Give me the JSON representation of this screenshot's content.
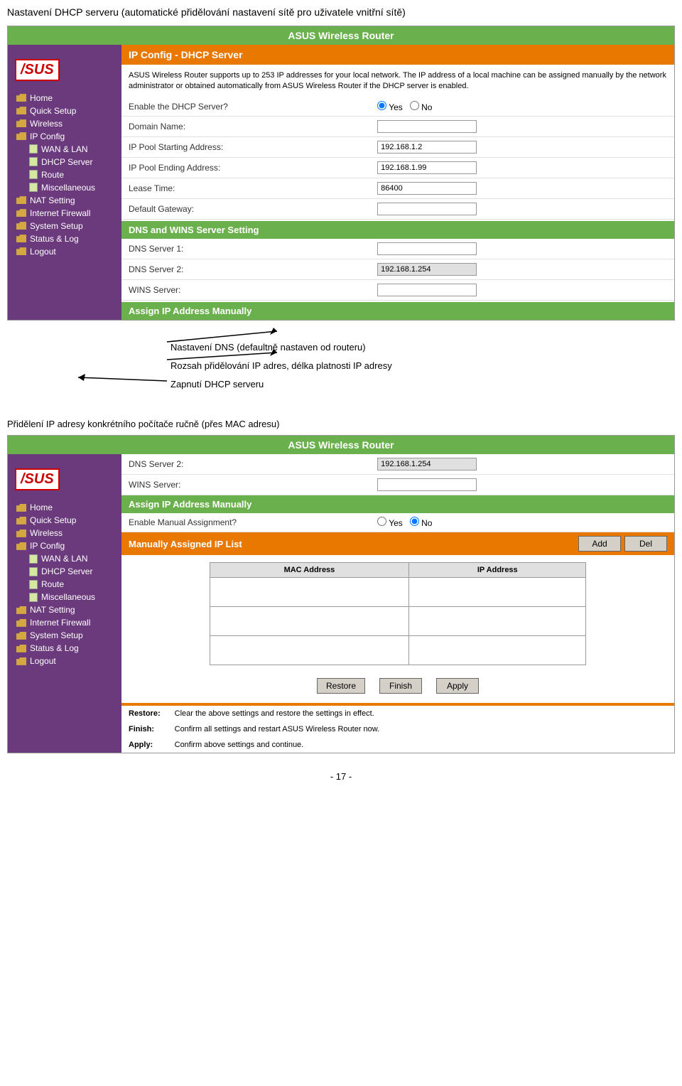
{
  "page": {
    "header": "Nastavení DHCP serveru (automatické přidělování nastavení sítě pro uživatele vnitřní sítě)",
    "router_title": "ASUS Wireless Router",
    "asus_logo": "/sus",
    "section1_title": "IP Config - DHCP Server",
    "info_text": "ASUS Wireless Router supports up to 253 IP addresses for your local network. The IP address of a local machine can be assigned manually by the network administrator or obtained automatically from ASUS Wireless Router if the DHCP server is enabled.",
    "fields": [
      {
        "label": "Enable the DHCP Server?",
        "type": "radio",
        "value": "Yes"
      },
      {
        "label": "Domain Name:",
        "type": "text",
        "value": ""
      },
      {
        "label": "IP Pool Starting Address:",
        "type": "text",
        "value": "192.168.1.2"
      },
      {
        "label": "IP Pool Ending Address:",
        "type": "text",
        "value": "192.168.1.99"
      },
      {
        "label": "Lease Time:",
        "type": "text",
        "value": "86400"
      },
      {
        "label": "Default Gateway:",
        "type": "text",
        "value": ""
      }
    ],
    "dns_section": "DNS and WINS Server Setting",
    "dns_fields": [
      {
        "label": "DNS Server 1:",
        "type": "text",
        "value": ""
      },
      {
        "label": "DNS Server 2:",
        "type": "text",
        "value": "192.168.1.254"
      },
      {
        "label": "WINS Server:",
        "type": "text",
        "value": ""
      }
    ],
    "assign_section": "Assign IP Address Manually",
    "sidebar_items": [
      {
        "label": "Home",
        "type": "folder"
      },
      {
        "label": "Quick Setup",
        "type": "folder"
      },
      {
        "label": "Wireless",
        "type": "folder"
      },
      {
        "label": "IP Config",
        "type": "folder"
      },
      {
        "label": "WAN & LAN",
        "type": "file",
        "sub": true
      },
      {
        "label": "DHCP Server",
        "type": "file",
        "sub": true
      },
      {
        "label": "Route",
        "type": "file",
        "sub": true
      },
      {
        "label": "Miscellaneous",
        "type": "file",
        "sub": true
      },
      {
        "label": "NAT Setting",
        "type": "folder"
      },
      {
        "label": "Internet Firewall",
        "type": "folder"
      },
      {
        "label": "System Setup",
        "type": "folder"
      },
      {
        "label": "Status & Log",
        "type": "folder"
      },
      {
        "label": "Logout",
        "type": "folder"
      }
    ],
    "annotation1": "Nastavení DNS (defaultně nastaven od routeru)",
    "annotation2": "Rozsah přidělování IP adres, délka platnosti IP adresy",
    "annotation3": "Zapnutí DHCP serveru",
    "assignment_header": "Přidělení IP adresy konkrétního počítače ručně (přes MAC adresu)",
    "panel2": {
      "dns_server2_label": "DNS Server 2:",
      "dns_server2_value": "192.168.1.254",
      "wins_label": "WINS Server:",
      "wins_value": "",
      "assign_ip_title": "Assign IP Address Manually",
      "enable_label": "Enable Manual Assignment?",
      "enable_value": "No",
      "manually_list_title": "Manually Assigned IP List",
      "add_btn": "Add",
      "del_btn": "Del",
      "mac_col": "MAC Address",
      "ip_col": "IP Address",
      "restore_btn": "Restore",
      "finish_btn": "Finish",
      "apply_btn": "Apply",
      "footer_rows": [
        {
          "label": "Restore:",
          "text": "Clear the above settings and restore the settings in effect."
        },
        {
          "label": "Finish:",
          "text": "Confirm all settings and restart ASUS Wireless Router now."
        },
        {
          "label": "Apply:",
          "text": "Confirm above settings and continue."
        }
      ],
      "sidebar_items": [
        {
          "label": "Home",
          "type": "folder"
        },
        {
          "label": "Quick Setup",
          "type": "folder"
        },
        {
          "label": "Wireless",
          "type": "folder"
        },
        {
          "label": "IP Config",
          "type": "folder"
        },
        {
          "label": "WAN & LAN",
          "type": "file",
          "sub": true
        },
        {
          "label": "DHCP Server",
          "type": "file",
          "sub": true
        },
        {
          "label": "Route",
          "type": "file",
          "sub": true
        },
        {
          "label": "Miscellaneous",
          "type": "file",
          "sub": true
        },
        {
          "label": "NAT Setting",
          "type": "folder"
        },
        {
          "label": "Internet Firewall",
          "type": "folder"
        },
        {
          "label": "System Setup",
          "type": "folder"
        },
        {
          "label": "Status & Log",
          "type": "folder"
        },
        {
          "label": "Logout",
          "type": "folder"
        }
      ]
    },
    "page_number": "- 17 -"
  }
}
